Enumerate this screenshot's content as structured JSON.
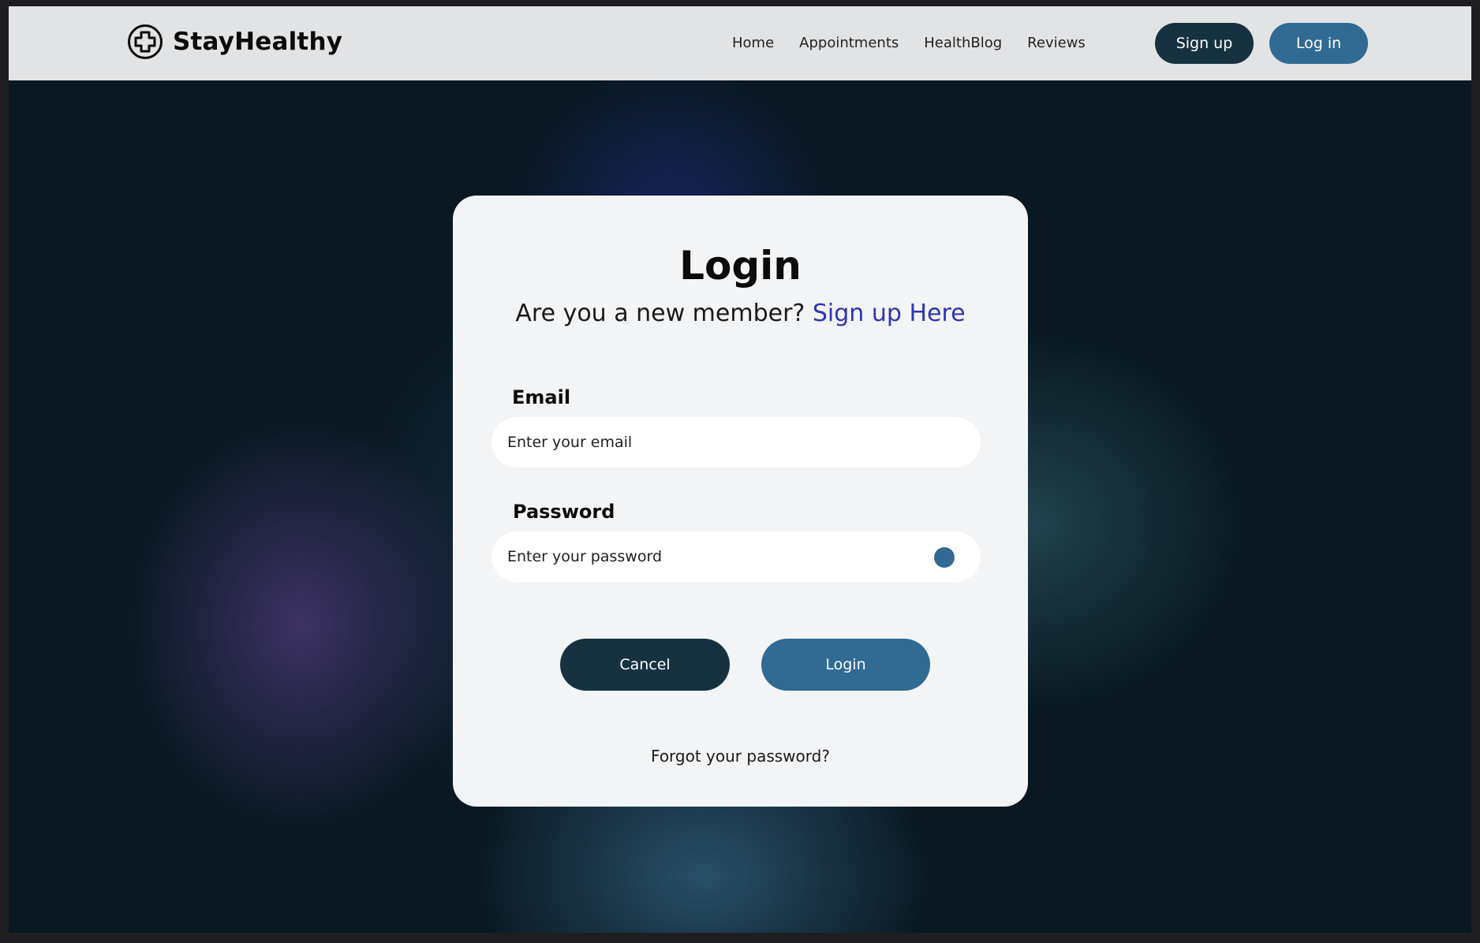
{
  "header": {
    "brand": "StayHealthy",
    "nav": [
      "Home",
      "Appointments",
      "HealthBlog",
      "Reviews"
    ],
    "signup_label": "Sign up",
    "login_label": "Log in"
  },
  "form": {
    "title": "Login",
    "subtitle_text": "Are you a new member? ",
    "subtitle_link": "Sign up Here",
    "email_label": "Email",
    "email_placeholder": "Enter your email",
    "password_label": "Password",
    "password_placeholder": "Enter your password",
    "cancel_label": "Cancel",
    "login_label": "Login",
    "forgot_label": "Forgot your password?"
  },
  "icons": {
    "logo": "medical-cross-icon",
    "password_toggle": "visibility-toggle-icon"
  },
  "colors": {
    "header_bg": "#e2e3e5",
    "dark_button": "#163241",
    "accent_button": "#316a92",
    "link": "#2d36b4",
    "card_bg": "#f3f4f6"
  }
}
